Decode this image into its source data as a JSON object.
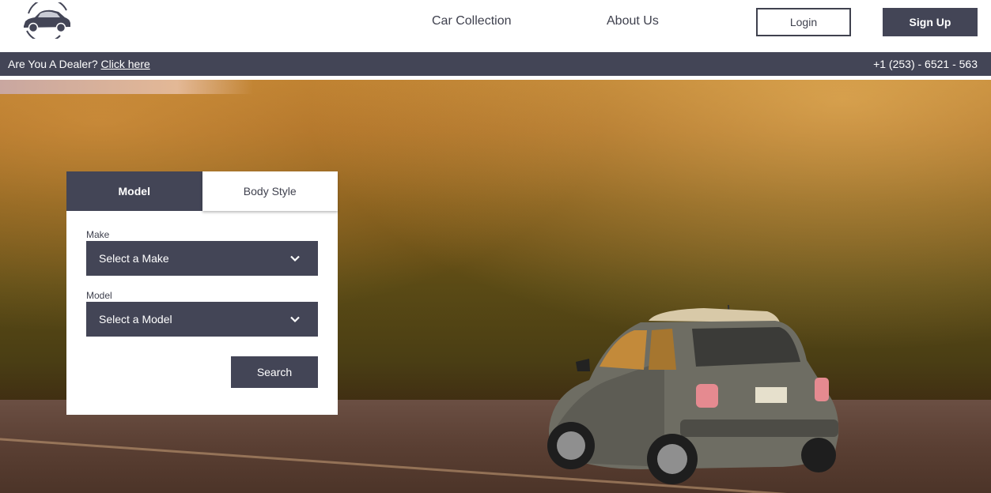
{
  "header": {
    "nav": [
      {
        "label": "Car Collection"
      },
      {
        "label": "About Us"
      }
    ],
    "login_label": "Login",
    "signup_label": "Sign Up"
  },
  "dealer_bar": {
    "question": "Are You A Dealer?",
    "link_label": "Click here",
    "phone": "+1 (253) - 6521 - 563"
  },
  "search_panel": {
    "tabs": [
      {
        "label": "Model",
        "active": true
      },
      {
        "label": "Body Style",
        "active": false
      }
    ],
    "make_label": "Make",
    "make_value": "Select a Make",
    "model_label": "Model",
    "model_value": "Select a Model",
    "search_label": "Search"
  },
  "colors": {
    "primary": "#434556",
    "text": "#3f414e",
    "background": "#ffffff"
  },
  "icons": [
    "car-logo-icon",
    "chevron-down-icon"
  ]
}
